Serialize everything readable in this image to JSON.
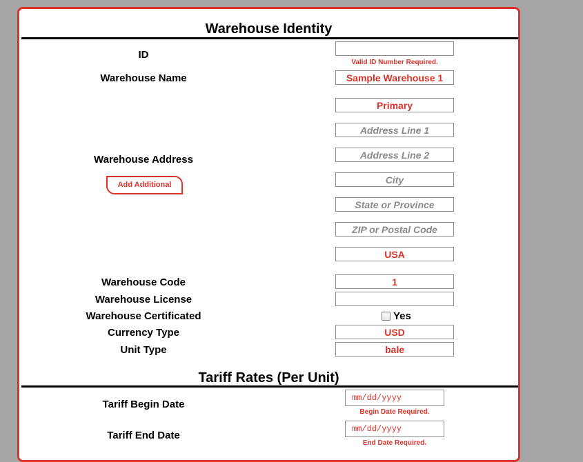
{
  "identity": {
    "title": "Warehouse Identity",
    "id_label": "ID",
    "id_value": "",
    "id_error": "Valid ID Number Required.",
    "name_label": "Warehouse Name",
    "name_value": "Sample Warehouse 1",
    "address_label": "Warehouse Address",
    "add_additional": "Add Additional",
    "address": {
      "type_value": "Primary",
      "line1_placeholder": "Address Line 1",
      "line2_placeholder": "Address Line 2",
      "city_placeholder": "City",
      "state_placeholder": "State or Province",
      "zip_placeholder": "ZIP or Postal Code",
      "country_value": "USA"
    },
    "code_label": "Warehouse Code",
    "code_value": "1",
    "license_label": "Warehouse License",
    "license_value": "",
    "certificated_label": "Warehouse Certificated",
    "certificated_option": "Yes",
    "currency_label": "Currency Type",
    "currency_value": "USD",
    "unit_label": "Unit Type",
    "unit_value": "bale"
  },
  "tariff": {
    "title": "Tariff Rates (Per Unit)",
    "begin_label": "Tariff Begin Date",
    "begin_placeholder": "mm/dd/yyyy",
    "begin_error": "Begin Date Required.",
    "end_label": "Tariff End Date",
    "end_placeholder": "mm/dd/yyyy",
    "end_error": "End Date Required."
  },
  "colors": {
    "accent": "#d9342b",
    "background": "#a6a6a6",
    "border": "#8a8a8a"
  }
}
